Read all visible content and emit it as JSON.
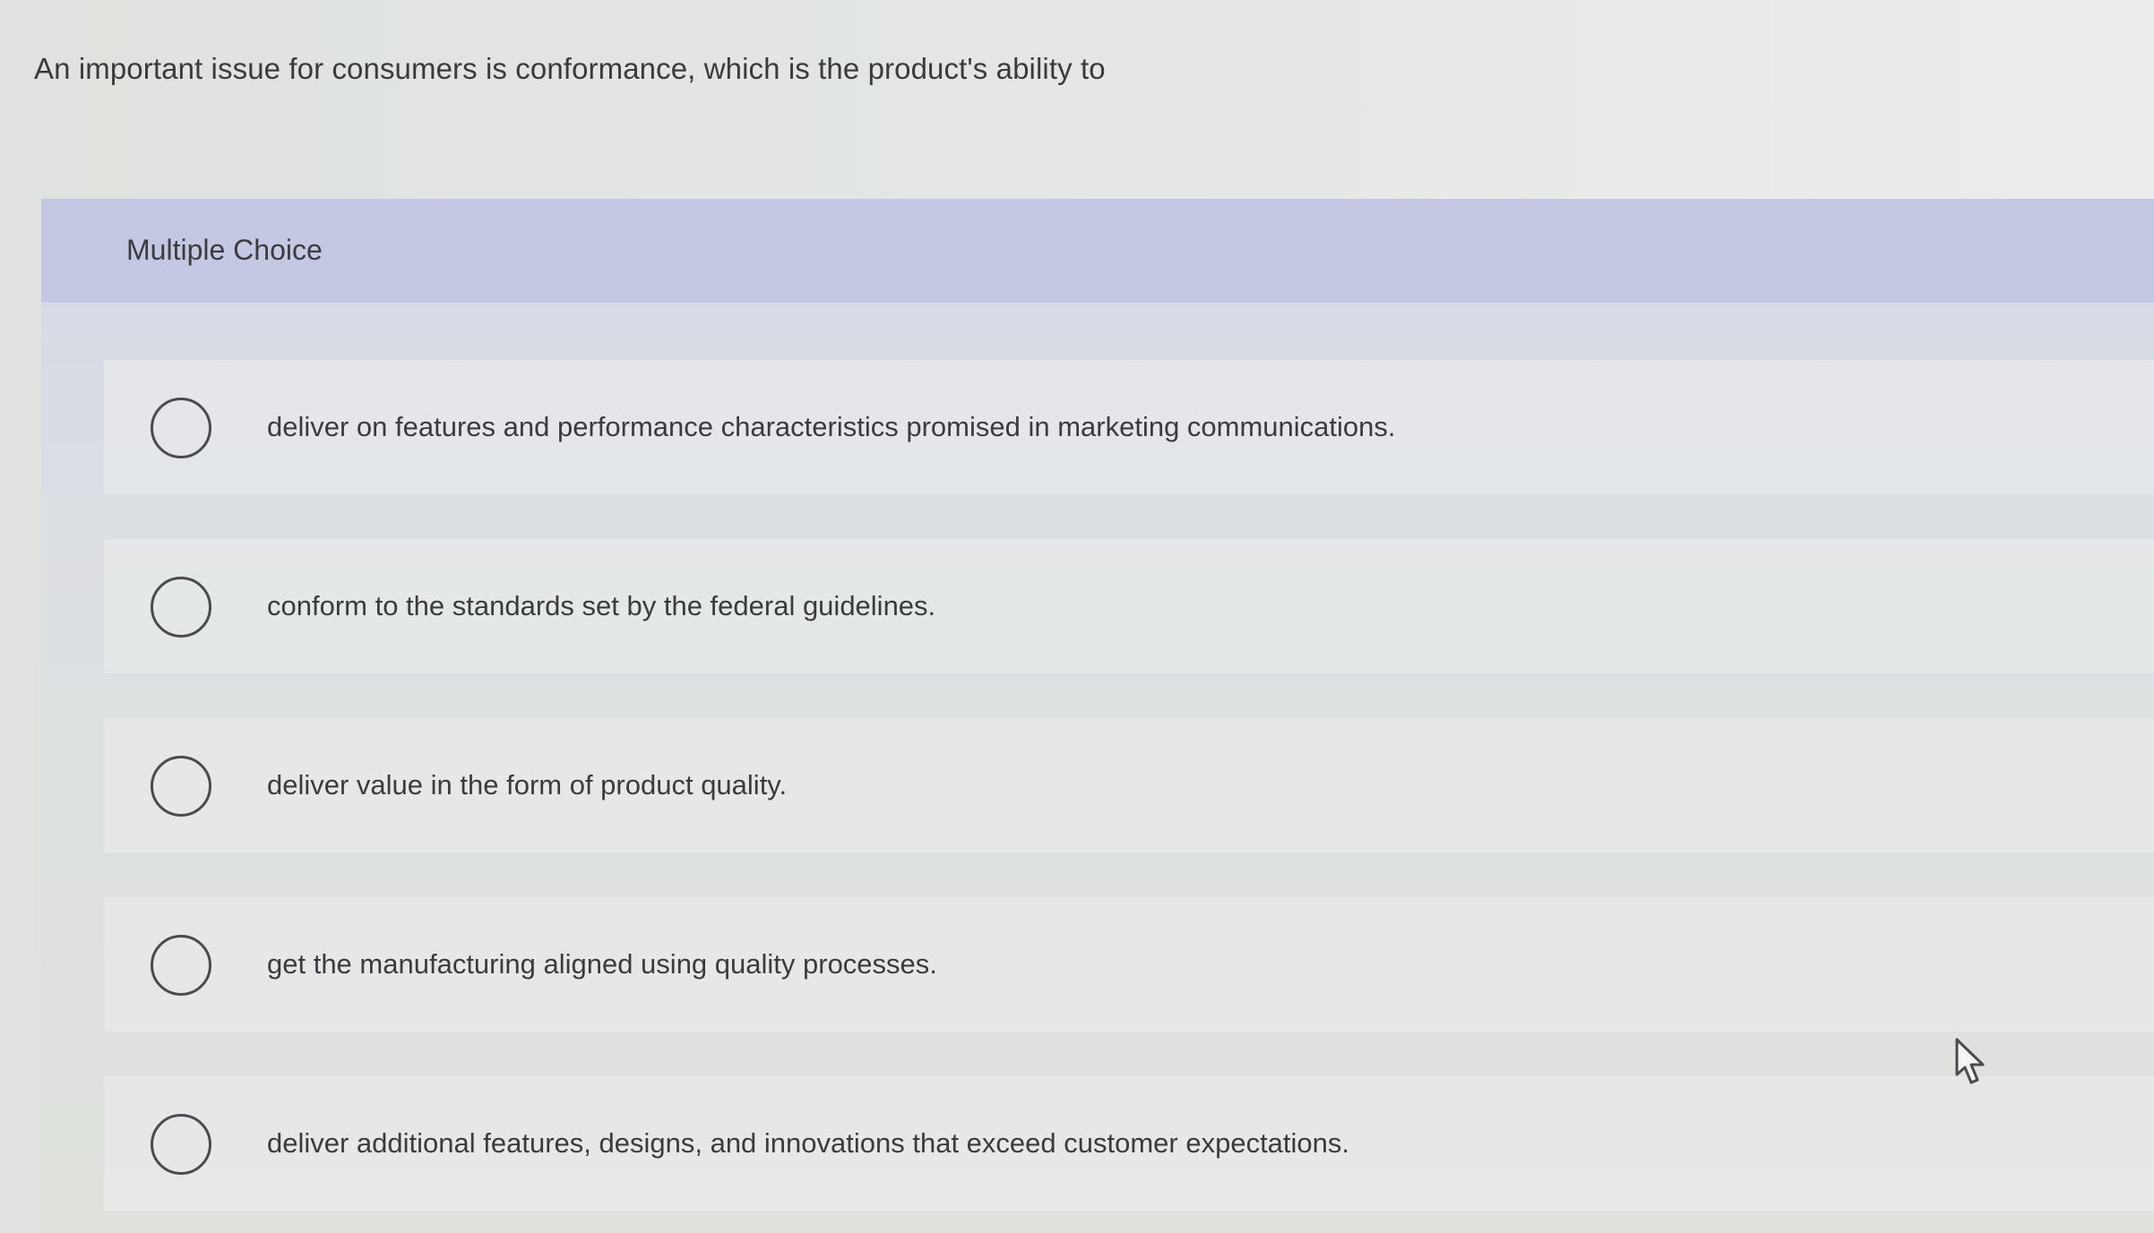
{
  "question": {
    "text": "An important issue for consumers is conformance, which is the product's ability to"
  },
  "multiple_choice": {
    "header_label": "Multiple Choice",
    "options": [
      {
        "label": "deliver on features and performance characteristics promised in marketing communications.",
        "selected": false
      },
      {
        "label": "conform to the standards set by the federal guidelines.",
        "selected": false
      },
      {
        "label": "deliver value in the form of product quality.",
        "selected": false
      },
      {
        "label": "get the manufacturing aligned using quality processes.",
        "selected": false
      },
      {
        "label": "deliver additional features, designs, and innovations that exceed customer expectations.",
        "selected": false
      }
    ]
  },
  "icons": {
    "radio": "radio-button-unselected-icon",
    "cursor": "mouse-pointer-icon"
  },
  "colors": {
    "header_background": "#c5c8e2",
    "text": "#3b3b3d"
  }
}
